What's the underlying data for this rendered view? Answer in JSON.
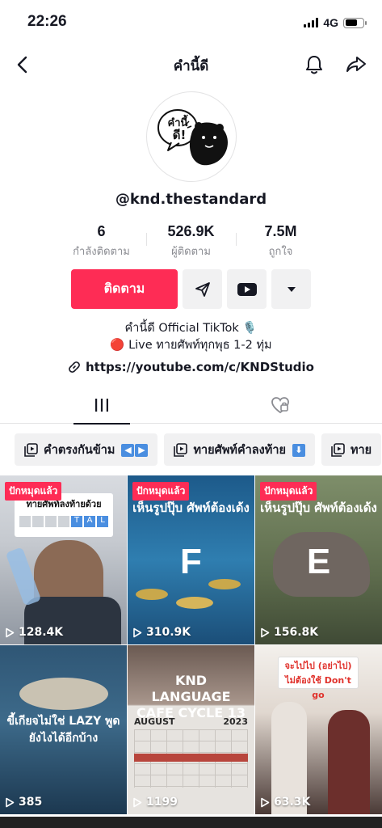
{
  "status": {
    "time": "22:26",
    "network": "4G"
  },
  "nav": {
    "title": "คำนี้ดี"
  },
  "profile": {
    "username": "@knd.thestandard",
    "avatar_text_1": "คำนี้",
    "avatar_text_2": "ดี!"
  },
  "stats": [
    {
      "value": "6",
      "label": "กำลังติดตาม"
    },
    {
      "value": "526.9K",
      "label": "ผู้ติดตาม"
    },
    {
      "value": "7.5M",
      "label": "ถูกใจ"
    }
  ],
  "actions": {
    "follow_label": "ติดตาม"
  },
  "bio": {
    "line1": "คำนี้ดี Official TikTok 🎙️",
    "line2": "🔴 Live ทายศัพท์ทุกพุธ 1-2 ทุ่ม",
    "link": "https://youtube.com/c/KNDStudio"
  },
  "playlists": [
    {
      "label": "คำตรงกันข้าม"
    },
    {
      "label": "ทายศัพท์คำลงท้าย"
    },
    {
      "label": "ทาย"
    }
  ],
  "videos": [
    {
      "views": "128.4K",
      "pinned": "ปักหมุดแล้ว",
      "caption": "ทายศัพท์ลงท้ายด้วย"
    },
    {
      "views": "310.9K",
      "pinned": "ปักหมุดแล้ว",
      "caption": "เห็นรูปปุ๊บ ศัพท์ต้องเด้ง",
      "letter": "F"
    },
    {
      "views": "156.8K",
      "pinned": "ปักหมุดแล้ว",
      "caption": "เห็นรูปปุ๊บ ศัพท์ต้องเด้ง",
      "letter": "E"
    },
    {
      "views": "385",
      "caption": "ขี้เกียจไม่ใช่ LAZY พูดยังไงได้อีกบ้าง"
    },
    {
      "views": "1199",
      "caption": "KND LANGUAGE CAFE CYCLE 13",
      "month": "AUGUST",
      "year": "2023"
    },
    {
      "views": "63.3K",
      "caption": "จะไปไป (อย่าไป) ไม่ต้องใช้ Don't go"
    }
  ],
  "colors": {
    "accent": "#fe2c55",
    "chip_bg": "#f1f1f2"
  }
}
